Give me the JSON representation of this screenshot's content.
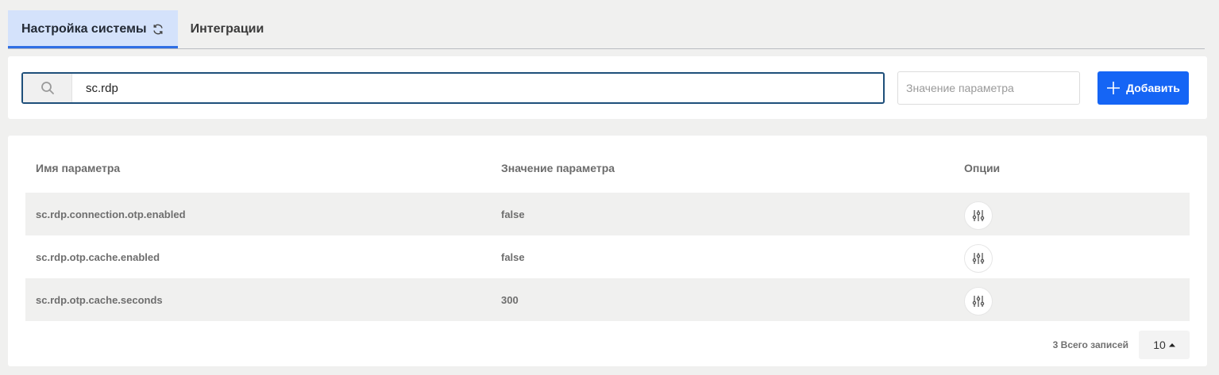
{
  "tabs": [
    {
      "label": "Настройка системы",
      "active": true,
      "icon": "refresh-icon"
    },
    {
      "label": "Интеграции",
      "active": false
    }
  ],
  "search": {
    "icon": "search-icon",
    "value": "sc.rdp",
    "value_placeholder": "Значение параметра",
    "add_label": "Добавить"
  },
  "table": {
    "headers": {
      "name": "Имя параметра",
      "value": "Значение параметра",
      "options": "Опции"
    },
    "rows": [
      {
        "name": "sc.rdp.connection.otp.enabled",
        "value": "false"
      },
      {
        "name": "sc.rdp.otp.cache.enabled",
        "value": "false"
      },
      {
        "name": "sc.rdp.otp.cache.seconds",
        "value": "300"
      }
    ],
    "options_icon": "sliders-icon"
  },
  "footer": {
    "total_text": "3 Всего записей",
    "page_size": "10"
  },
  "colors": {
    "accent": "#1565f5",
    "active_tab_bg": "#d4e2fb",
    "search_border": "#1e4f7a"
  }
}
